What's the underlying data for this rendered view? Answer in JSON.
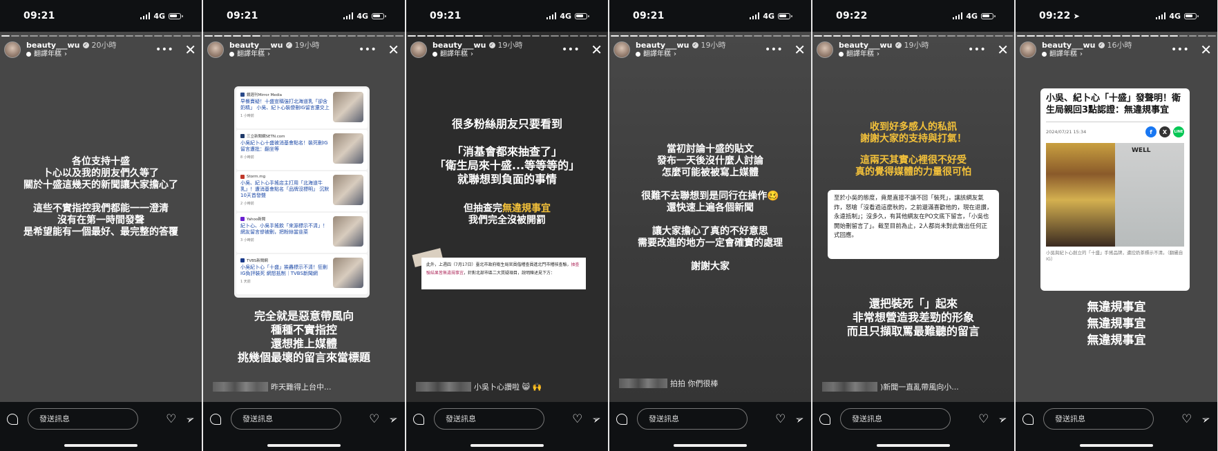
{
  "stories": [
    {
      "status": {
        "time": "09:21",
        "network": "4G",
        "location_arrow": false
      },
      "progress_done": 1,
      "user": {
        "name": "beauty___wu",
        "age": "20小時",
        "translate": "翻譯年糕"
      },
      "lines_a": [
        "各位支持十盛",
        "卜心以及我的朋友們久等了",
        "關於十盛這幾天的新聞讓大家擔心了"
      ],
      "lines_b": [
        "這些不實指控我們都能一一澄清",
        "沒有在第一時間發聲",
        "是希望能有一個最好、最完整的答覆"
      ],
      "reply_text": "",
      "message_placeholder": "發送訊息"
    },
    {
      "status": {
        "time": "09:21",
        "network": "4G",
        "location_arrow": false
      },
      "progress_done": 6,
      "user": {
        "name": "beauty___wu",
        "age": "19小時",
        "translate": "翻譯年糕"
      },
      "news": [
        {
          "source": "鏡週刊Mirror Media",
          "title": "早餐賣疑！十盛宣稱強打北海道乳「卻含奶精」 小吳、紀卜心裝傻刪IG留言還交上",
          "time": "1 小時前",
          "logo_color": "#2a4a8a"
        },
        {
          "source": "三立新聞網SETN.com",
          "title": "小吳紀卜心十盛被消基會點名！裝死刪IG留言遭批：翻坐等",
          "time": "8 小時前",
          "logo_color": "#1f3a6a"
        },
        {
          "source": "Storm.mg",
          "title": "小吳、紀卜心手搖店主打用「北海道牛乳」！遭消基會點名「品牌沒標明」 沉默10天首發聲",
          "time": "2 小時前",
          "logo_color": "#c0392b"
        },
        {
          "source": "Yahoo新聞",
          "title": "紀卜心、小吳手搖飲「來源標示不清」！網友留言慘被刪，把粉絲當韭菜",
          "time": "3 小時前",
          "logo_color": "#6a1fd0"
        },
        {
          "source": "TVBS新聞網",
          "title": "小吳紀卜心「十盛」挨轟標示不清！狂刪IG負評裝死 網怒抵制｜TVBS新聞網",
          "time": "1 天前",
          "logo_color": "#1a3a8a"
        }
      ],
      "lines": [
        "完全就是惡意帶風向",
        "種種不實指控",
        "還想推上媒體",
        "挑幾個最壞的留言來當標題"
      ],
      "reply_text": "昨天難得上台中...",
      "message_placeholder": "發送訊息"
    },
    {
      "status": {
        "time": "09:21",
        "network": "4G",
        "location_arrow": false
      },
      "progress_done": 8,
      "user": {
        "name": "beauty___wu",
        "age": "19小時",
        "translate": "翻譯年糕"
      },
      "lines_a": [
        "很多粉絲朋友只要看到"
      ],
      "lines_b": [
        "「消基會都來抽查了」",
        "「衛生局來十盛...等等等的」",
        "就聯想到負面的事情"
      ],
      "line_c_prefix": "但抽查完",
      "line_c_highlight": "無違規事宜",
      "line_d": "我們完全沒被開罰",
      "doc": {
        "part1": "此外，上週四（7月17日）臺北市政府衛生局官員偕稽查員進北門市稽核查驗，",
        "highlight": "抽查驗結果皆無違規事宜",
        "part2": "，針對北部市區二大質疑項目，說明陳述見下方："
      },
      "reply_text": "小吳卜心讚啦 😸 🙌",
      "message_placeholder": "發送訊息"
    },
    {
      "status": {
        "time": "09:21",
        "network": "4G",
        "location_arrow": false
      },
      "progress_done": 10,
      "user": {
        "name": "beauty___wu",
        "age": "19小時",
        "translate": "翻譯年糕"
      },
      "lines_a": [
        "當初討論十盛的貼文",
        "發布一天後沒什麼人討論",
        "怎麼可能被被寫上媒體"
      ],
      "lines_b": [
        "很難不去聯想到是同行在操作🥴",
        "還快速上遍各個新聞"
      ],
      "lines_c": [
        "讓大家擔心了真的不好意思",
        "需要改進的地方一定會確實的處理"
      ],
      "lines_d": [
        "謝謝大家"
      ],
      "reply_text": "拍拍 你們很棒",
      "message_placeholder": "發送訊息"
    },
    {
      "status": {
        "time": "09:22",
        "network": "4G",
        "location_arrow": false
      },
      "progress_done": 11,
      "user": {
        "name": "beauty___wu",
        "age": "19小時",
        "translate": "翻譯年糕"
      },
      "gold_a": [
        "收到好多感人的私訊",
        "謝謝大家的支持與打氣！"
      ],
      "gold_b": [
        "這兩天其實心裡很不好受",
        "真的覺得媒體的力量很可怕"
      ],
      "quote": "至於小吳的態度，竟是直接不讀不回「裝死」，讓該網友氣炸，怒嗆「沒看過這麼秋的，之前還滿喜歡他的，現在退讚，永遠抵制」；沒多久，有其他網友在PO文底下留言，「小吳也開始刪留言了」。截至目前為止，2人都尚未對此做出任何正式回應。",
      "lines": [
        "還把裝死「」起來",
        "非常想營造我差勁的形象",
        "而且只擷取罵最難聽的留言"
      ],
      "reply_text": ")新聞一直亂帶風向小...",
      "message_placeholder": "發送訊息"
    },
    {
      "status": {
        "time": "09:22",
        "network": "4G",
        "location_arrow": true
      },
      "progress_done": 17,
      "user": {
        "name": "beauty___wu",
        "age": "16小時",
        "translate": "翻譯年糕"
      },
      "article": {
        "title": "小吳、紀卜心「十盛」發聲明！衛生局親回3點認證：無違規事宜",
        "date": "2024/07/21 15:34",
        "share": {
          "facebook": "f",
          "x": "X",
          "line": "LINE"
        },
        "photo_sign": "WELL",
        "caption": "小吳與紀卜心創立的「十盛」手搖品牌，遭控奶茶標示不清。（翻攝自IG）"
      },
      "lines": [
        "無違規事宜",
        "無違規事宜",
        "無違規事宜"
      ],
      "reply_text": "",
      "message_placeholder": "發送訊息"
    }
  ],
  "progress_total": 21
}
